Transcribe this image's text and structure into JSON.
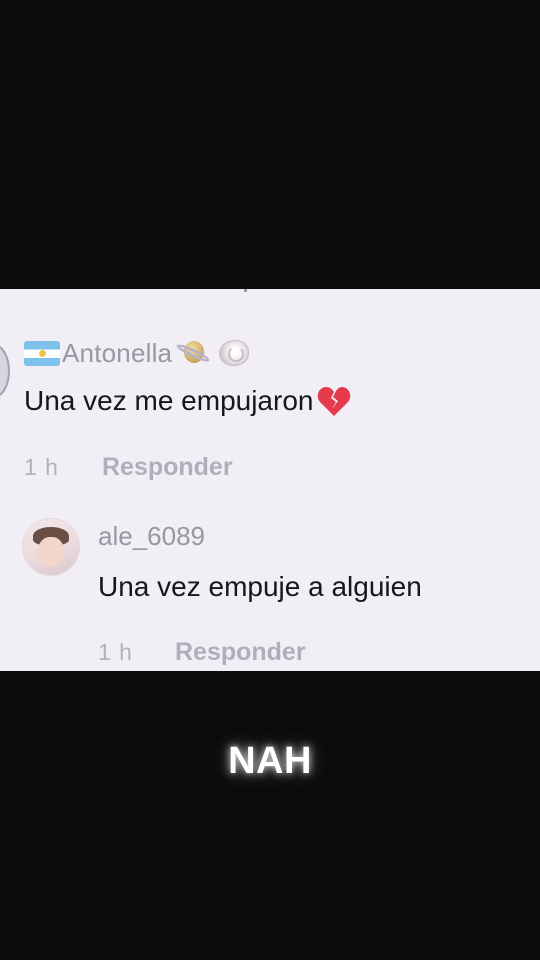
{
  "comment": {
    "username": "Antonella",
    "flag_icon": "argentina-flag-icon",
    "decor_icons": [
      "ringed-planet-icon",
      "spiral-shell-icon"
    ],
    "text": "Una vez me empujaron",
    "emoji_icon": "broken-heart-icon",
    "time": "1 h",
    "reply_label": "Responder"
  },
  "reply": {
    "username": "ale_6089",
    "text": "Una vez empuje a alguien",
    "time": "1 h",
    "reply_label": "Responder"
  },
  "caption": "NAH",
  "colors": {
    "background": "#0c0b09",
    "panel": "#f1eff5",
    "username": "#9a97a3",
    "text": "#17161b",
    "meta": "#b3b0ba",
    "heart": "#e63a4d"
  }
}
